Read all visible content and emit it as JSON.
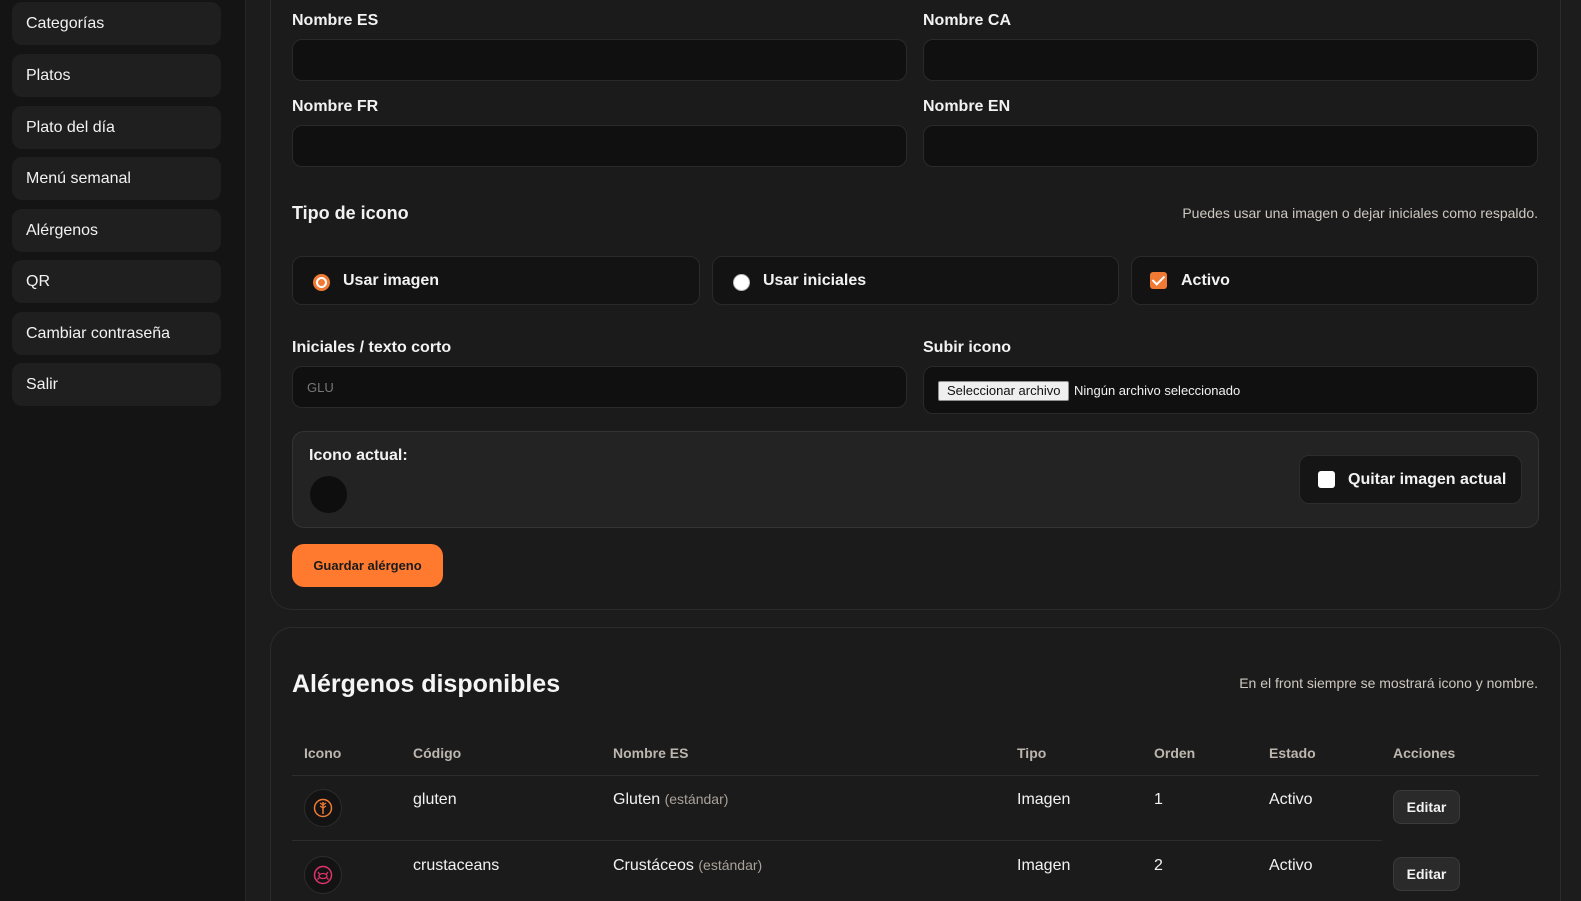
{
  "sidebar": {
    "items": [
      {
        "label": "Categorías"
      },
      {
        "label": "Platos"
      },
      {
        "label": "Plato del día"
      },
      {
        "label": "Menú semanal"
      },
      {
        "label": "Alérgenos"
      },
      {
        "label": "QR"
      },
      {
        "label": "Cambiar contraseña"
      },
      {
        "label": "Salir"
      }
    ]
  },
  "form": {
    "name_es_label": "Nombre ES",
    "name_ca_label": "Nombre CA",
    "name_fr_label": "Nombre FR",
    "name_en_label": "Nombre EN",
    "name_es_value": "",
    "name_ca_value": "",
    "name_fr_value": "",
    "name_en_value": "",
    "icon_type_title": "Tipo de icono",
    "icon_type_hint": "Puedes usar una imagen o dejar iniciales como respaldo.",
    "use_image_label": "Usar imagen",
    "use_initials_label": "Usar iniciales",
    "active_label": "Activo",
    "icon_type_selected": "image",
    "active_checked": true,
    "initials_label": "Iniciales / texto corto",
    "initials_placeholder": "GLU",
    "initials_value": "",
    "upload_label": "Subir icono",
    "file_button_label": "Seleccionar archivo",
    "file_status": "Ningún archivo seleccionado",
    "current_icon_label": "Icono actual:",
    "remove_image_label": "Quitar imagen actual",
    "remove_image_checked": false,
    "save_button_label": "Guardar alérgeno",
    "accent_color": "#ff7a2f"
  },
  "list": {
    "title": "Alérgenos disponibles",
    "hint": "En el front siempre se mostrará icono y nombre.",
    "columns": [
      "Icono",
      "Código",
      "Nombre ES",
      "Tipo",
      "Orden",
      "Estado",
      "Acciones"
    ],
    "rows": [
      {
        "icon": "wheat-icon",
        "code": "gluten",
        "name": "Gluten",
        "tag": "(estándar)",
        "type": "Imagen",
        "order": "1",
        "status": "Activo",
        "action": "Editar"
      },
      {
        "icon": "crab-icon",
        "code": "crustaceans",
        "name": "Crustáceos",
        "tag": "(estándar)",
        "type": "Imagen",
        "order": "2",
        "status": "Activo",
        "action": "Editar"
      }
    ]
  }
}
